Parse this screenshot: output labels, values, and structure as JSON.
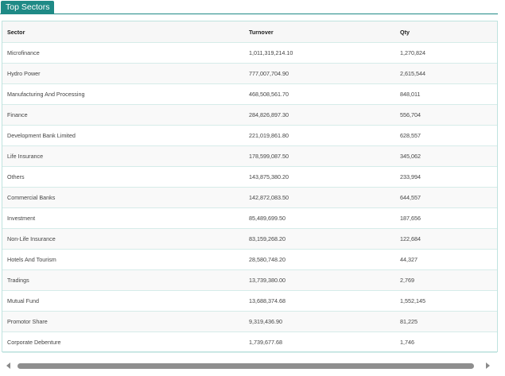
{
  "tab": {
    "label": "Top Sectors"
  },
  "table": {
    "headers": [
      "Sector",
      "Turnover",
      "Qty"
    ],
    "rows": [
      [
        "Microfinance",
        "1,011,319,214.10",
        "1,270,824"
      ],
      [
        "Hydro Power",
        "777,007,704.90",
        "2,615,544"
      ],
      [
        "Manufacturing And Processing",
        "468,508,561.70",
        "848,011"
      ],
      [
        "Finance",
        "284,826,897.30",
        "556,704"
      ],
      [
        "Development Bank Limited",
        "221,019,861.80",
        "628,557"
      ],
      [
        "Life Insurance",
        "178,599,087.50",
        "345,062"
      ],
      [
        "Others",
        "143,875,380.20",
        "233,994"
      ],
      [
        "Commercial Banks",
        "142,872,083.50",
        "644,557"
      ],
      [
        "Investment",
        "85,489,699.50",
        "187,656"
      ],
      [
        "Non-Life Insurance",
        "83,159,268.20",
        "122,684"
      ],
      [
        "Hotels And Tourism",
        "28,580,748.20",
        "44,327"
      ],
      [
        "Tradings",
        "13,739,380.00",
        "2,769"
      ],
      [
        "Mutual Fund",
        "13,688,374.68",
        "1,552,145"
      ],
      [
        "Promotor Share",
        "9,319,436.90",
        "81,225"
      ],
      [
        "Corporate Debenture",
        "1,739,677.68",
        "1,746"
      ]
    ]
  },
  "scrollbar": {
    "left_icon": "chevron-left-icon",
    "right_icon": "chevron-right-icon"
  },
  "colors": {
    "accent": "#1f8a86",
    "border": "#bfe3df"
  }
}
